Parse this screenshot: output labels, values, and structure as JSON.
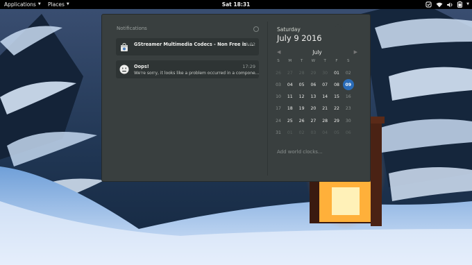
{
  "topbar": {
    "applications_label": "Applications",
    "places_label": "Places",
    "clock": "Sat 18:31",
    "tray_icons": [
      "night-light-icon",
      "wifi-icon",
      "volume-icon",
      "battery-icon",
      "power-icon"
    ]
  },
  "notifications": {
    "header": "Notifications",
    "items": [
      {
        "icon": "software-bag-icon",
        "title": "GStreamer Multimedia Codecs - Non Free is ...",
        "time": "18:02",
        "body": ""
      },
      {
        "icon": "sad-face-icon",
        "title": "Oops!",
        "time": "17:29",
        "body": "We're sorry, it looks like a problem occurred in a compone..."
      }
    ]
  },
  "calendar": {
    "weekday": "Saturday",
    "date": "July  9 2016",
    "month": "July",
    "day_headers": [
      "S",
      "M",
      "T",
      "W",
      "T",
      "F",
      "S"
    ],
    "weeks": [
      [
        "26",
        "27",
        "28",
        "29",
        "30",
        "01",
        "02"
      ],
      [
        "03",
        "04",
        "05",
        "06",
        "07",
        "08",
        "09"
      ],
      [
        "10",
        "11",
        "12",
        "13",
        "14",
        "15",
        "16"
      ],
      [
        "17",
        "18",
        "19",
        "20",
        "21",
        "22",
        "23"
      ],
      [
        "24",
        "25",
        "26",
        "27",
        "28",
        "29",
        "30"
      ],
      [
        "31",
        "01",
        "02",
        "03",
        "04",
        "05",
        "06"
      ]
    ],
    "today": "09",
    "world_clocks_link": "Add world clocks..."
  },
  "colors": {
    "topbar_bg": "#000000",
    "popover_bg": "#393f3f",
    "today_accent": "#2a6cb8"
  }
}
